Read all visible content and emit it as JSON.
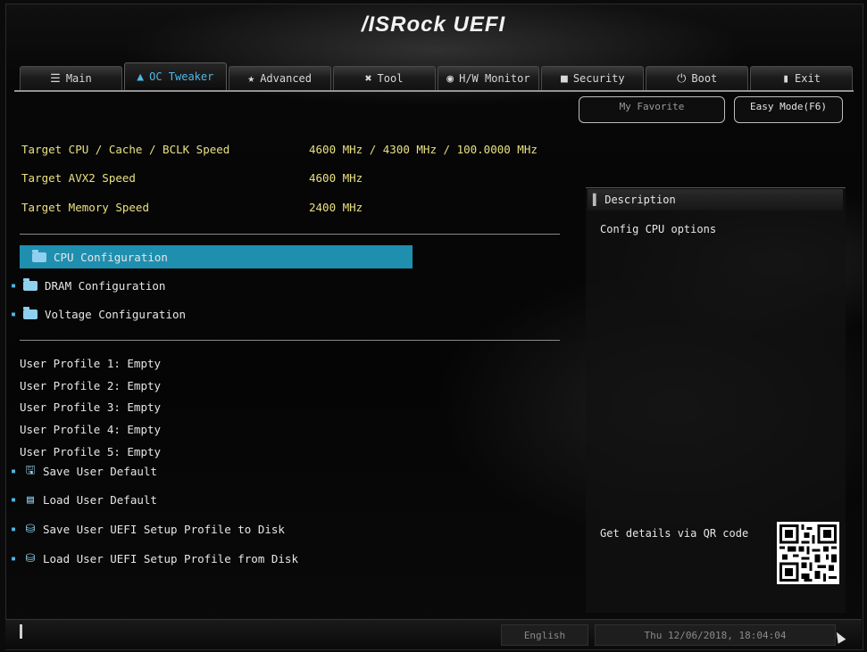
{
  "app": {
    "title": "/ISRock UEFI"
  },
  "tabs": [
    {
      "label": "Main",
      "icon": "list-icon",
      "glyph": "☰"
    },
    {
      "label": "OC Tweaker",
      "icon": "flame-icon",
      "glyph": "▲"
    },
    {
      "label": "Advanced",
      "icon": "star-icon",
      "glyph": "★"
    },
    {
      "label": "Tool",
      "icon": "tool-icon",
      "glyph": "✖"
    },
    {
      "label": "H/W Monitor",
      "icon": "monitor-icon",
      "glyph": "◉"
    },
    {
      "label": "Security",
      "icon": "shield-icon",
      "glyph": "■"
    },
    {
      "label": "Boot",
      "icon": "power-icon",
      "glyph": "⏻"
    },
    {
      "label": "Exit",
      "icon": "exit-icon",
      "glyph": "▮"
    }
  ],
  "active_tab": "OC Tweaker",
  "favorite_button": "My Favorite",
  "easy_mode_button": "Easy Mode(F6)",
  "info": [
    {
      "label": "Target CPU / Cache / BCLK Speed",
      "value": "4600 MHz / 4300 MHz / 100.0000 MHz"
    },
    {
      "label": "Target AVX2 Speed",
      "value": "4600 MHz"
    },
    {
      "label": "Target Memory Speed",
      "value": "2400 MHz"
    }
  ],
  "menu": [
    {
      "label": "CPU Configuration",
      "selected": true
    },
    {
      "label": "DRAM Configuration",
      "selected": false
    },
    {
      "label": "Voltage Configuration",
      "selected": false
    }
  ],
  "profiles": [
    "User Profile 1: Empty",
    "User Profile 2: Empty",
    "User Profile 3: Empty",
    "User Profile 4: Empty",
    "User Profile 5: Empty"
  ],
  "actions": [
    {
      "label": "Save User Default",
      "icon": "save-icon"
    },
    {
      "label": "Load User Default",
      "icon": "load-icon"
    },
    {
      "label": "Save User UEFI Setup Profile to Disk",
      "icon": "disk-save-icon"
    },
    {
      "label": "Load User UEFI Setup Profile from Disk",
      "icon": "disk-load-icon"
    }
  ],
  "description": {
    "header": "Description",
    "text": "Config CPU options",
    "qr_label": "Get details via QR code"
  },
  "footer": {
    "language": "English",
    "datetime": "Thu 12/06/2018, 18:04:04"
  },
  "colors": {
    "accent": "#1f8fb0",
    "info_text": "#e8e082",
    "active_tab": "#4fb8e6"
  }
}
